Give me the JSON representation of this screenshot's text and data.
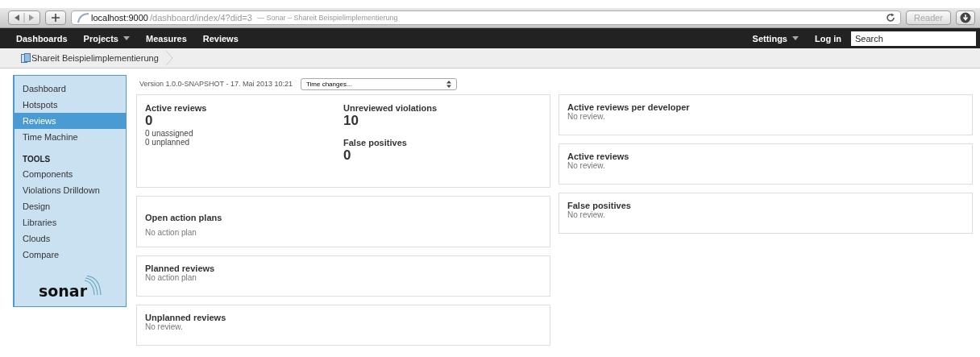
{
  "browser": {
    "url_host": "localhost:9000",
    "url_path": "/dashboard/index/4?did=3",
    "page_title": "— Sonar – Shareit Beispielimplementierung",
    "reader": "Reader"
  },
  "nav": {
    "left": [
      {
        "label": "Dashboards",
        "dropdown": false
      },
      {
        "label": "Projects",
        "dropdown": true
      },
      {
        "label": "Measures",
        "dropdown": false
      },
      {
        "label": "Reviews",
        "dropdown": false
      }
    ],
    "right": [
      {
        "label": "Settings",
        "dropdown": true
      },
      {
        "label": "Log in",
        "dropdown": false
      }
    ],
    "search": {
      "placeholder": "Search"
    }
  },
  "breadcrumb": [
    "Shareit Beispielimplementierung"
  ],
  "sidebar": {
    "items": [
      {
        "kind": "link",
        "label": "Dashboard",
        "selected": false
      },
      {
        "kind": "link",
        "label": "Hotspots",
        "selected": false
      },
      {
        "kind": "link",
        "label": "Reviews",
        "selected": true
      },
      {
        "kind": "link",
        "label": "Time Machine",
        "selected": false
      },
      {
        "kind": "header",
        "label": "TOOLS"
      },
      {
        "kind": "link",
        "label": "Components",
        "selected": false
      },
      {
        "kind": "link",
        "label": "Violations Drilldown",
        "selected": false
      },
      {
        "kind": "link",
        "label": "Design",
        "selected": false
      },
      {
        "kind": "link",
        "label": "Libraries",
        "selected": false
      },
      {
        "kind": "link",
        "label": "Clouds",
        "selected": false
      },
      {
        "kind": "link",
        "label": "Compare",
        "selected": false
      }
    ],
    "logo": "sonar"
  },
  "version": "Version 1.0.0-SNAPSHOT - 17. Mai 2013 10:21",
  "time_select": "Time changes...",
  "left_widgets": [
    {
      "kind": "metrics",
      "columns": [
        [
          {
            "title": "Active reviews",
            "value": "0",
            "notes": [
              "0 unassigned",
              "0 unplanned"
            ]
          }
        ],
        [
          {
            "title": "Unreviewed violations",
            "value": "10"
          },
          {
            "title": "False positives",
            "value": "0"
          }
        ]
      ]
    },
    {
      "kind": "spaced",
      "title": "Open action plans",
      "text": "No action plan"
    },
    {
      "kind": "plain",
      "title": "Planned reviews",
      "text": "No action plan"
    },
    {
      "kind": "plain",
      "title": "Unplanned reviews",
      "text": "No review."
    }
  ],
  "right_widgets": [
    {
      "title": "Active reviews per developer",
      "text": "No review."
    },
    {
      "title": "Active reviews",
      "text": "No review."
    },
    {
      "title": "False positives",
      "text": "No review."
    }
  ]
}
